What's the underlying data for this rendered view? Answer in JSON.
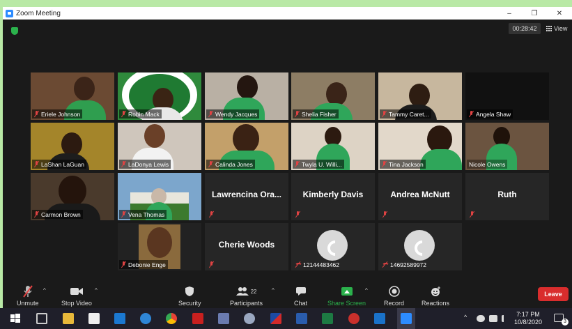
{
  "window": {
    "title": "Zoom Meeting",
    "min_glyph": "–",
    "max_glyph": "❐",
    "close_glyph": "✕"
  },
  "header": {
    "timer": "00:28:42",
    "view_label": "View"
  },
  "participants": [
    {
      "name": "Eriele Johnson",
      "bg": "#6b4a33"
    },
    {
      "name": "Robin Mack",
      "bg": "#2f8a3c"
    },
    {
      "name": "Wendy Jacques",
      "bg": "#b9b0a4"
    },
    {
      "name": "Shelia Fisher",
      "bg": "#8d7d64"
    },
    {
      "name": "Tammy Caret...",
      "bg": "#c7b79e"
    },
    {
      "name": "Angela Shaw",
      "bg": "#111111"
    },
    {
      "name": "LaShan LaGuan",
      "bg": "#a4852a"
    },
    {
      "name": "LaDonya Lewis",
      "bg": "#cfc6bc"
    },
    {
      "name": "Calinda Jones",
      "bg": "#c3a06a"
    },
    {
      "name": "Twyla U. Willi...",
      "bg": "#ddd3c5"
    },
    {
      "name": "Tina Jackson",
      "bg": "#e2d8ca"
    },
    {
      "name": "Nicole Owens",
      "bg": "#6b5440"
    },
    {
      "name": "Carmon Brown",
      "bg": "#4a3a2c"
    },
    {
      "name": "Vena Thomas",
      "bg": "#7ca6cc"
    },
    {
      "name": "Lawrencina Ora...",
      "bg": ""
    },
    {
      "name": "Kimberly Davis",
      "bg": ""
    },
    {
      "name": "Andrea McNutt",
      "bg": ""
    },
    {
      "name": "Ruth",
      "bg": ""
    },
    {
      "name": "Debonie Enge",
      "bg": "#8a6a3d"
    },
    {
      "name": "Cherie Woods",
      "bg": ""
    },
    {
      "name": "12144483462",
      "bg": ""
    },
    {
      "name": "14692589972",
      "bg": ""
    }
  ],
  "toolbar": {
    "unmute": "Unmute",
    "stop_video": "Stop Video",
    "security": "Security",
    "participants": "Participants",
    "participants_count": "22",
    "chat": "Chat",
    "share_screen": "Share Screen",
    "record": "Record",
    "reactions": "Reactions",
    "leave": "Leave"
  },
  "taskbar": {
    "time": "7:17 PM",
    "date": "10/8/2020",
    "notifications": "3",
    "caret": "^"
  },
  "colors": {
    "accent_green": "#2bb24c",
    "leave_red": "#d92d2d",
    "active_speaker": "#e3e24f"
  }
}
